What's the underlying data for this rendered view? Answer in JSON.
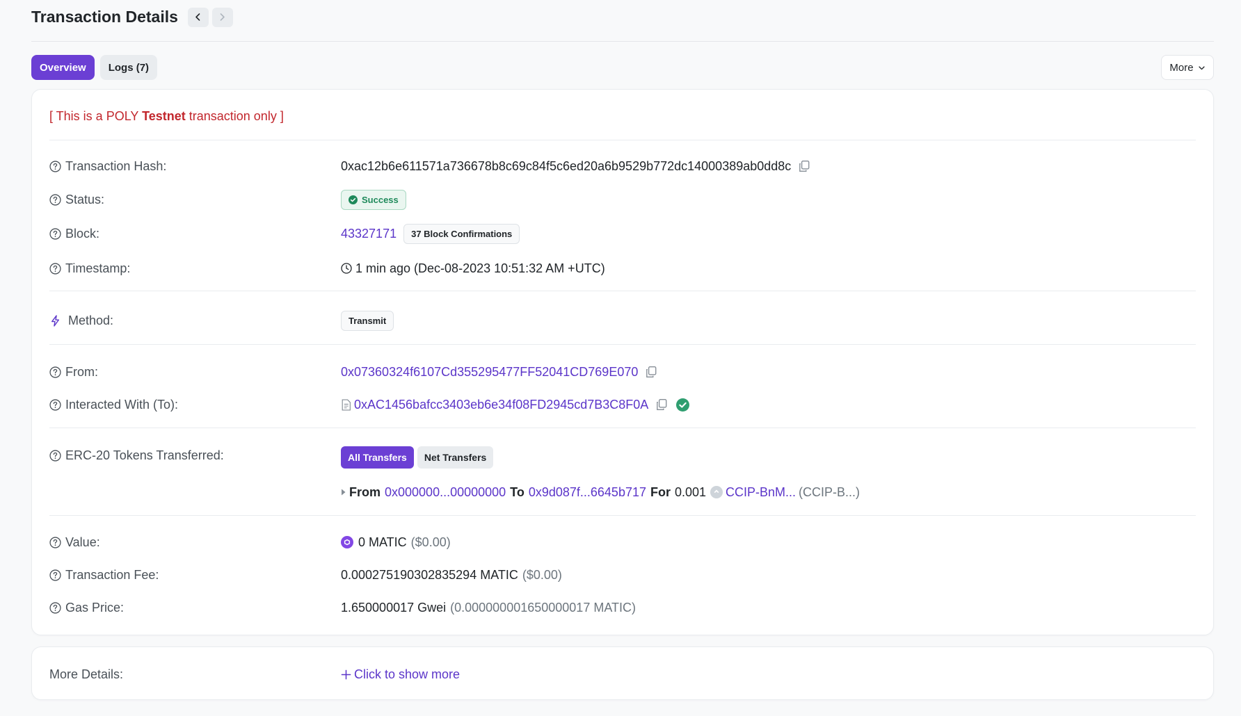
{
  "header": {
    "title": "Transaction Details"
  },
  "tabs": [
    {
      "label": "Overview",
      "active": true
    },
    {
      "label": "Logs (7)",
      "active": false
    }
  ],
  "more_label": "More",
  "notice": {
    "prefix": "[ This is a POLY ",
    "bold": "Testnet",
    "suffix": " transaction only ]"
  },
  "fields": {
    "tx_hash": {
      "label": "Transaction Hash:",
      "value": "0xac12b6e611571a736678b8c69c84f5c6ed20a6b9529b772dc14000389ab0dd8c"
    },
    "status": {
      "label": "Status:",
      "value": "Success"
    },
    "block": {
      "label": "Block:",
      "value": "43327171",
      "confirmations": "37 Block Confirmations"
    },
    "timestamp": {
      "label": "Timestamp:",
      "value": "1 min ago (Dec-08-2023 10:51:32 AM +UTC)"
    },
    "method": {
      "label": "Method:",
      "value": "Transmit"
    },
    "from": {
      "label": "From:",
      "value": "0x07360324f6107Cd355295477FF52041CD769E070"
    },
    "to": {
      "label": "Interacted With (To):",
      "value": "0xAC1456bafcc3403eb6e34f08FD2945cd7B3C8F0A"
    },
    "erc20": {
      "label": "ERC-20 Tokens Transferred:",
      "buttons": [
        "All Transfers",
        "Net Transfers"
      ],
      "transfer": {
        "from_kw": "From",
        "from_addr": "0x000000...00000000",
        "to_kw": "To",
        "to_addr": "0x9d087f...6645b717",
        "for_kw": "For",
        "amount": "0.001",
        "token": "CCIP-BnM...",
        "token_symbol": "(CCIP-B...)"
      }
    },
    "value": {
      "label": "Value:",
      "amount": "0 MATIC",
      "usd": "($0.00)"
    },
    "fee": {
      "label": "Transaction Fee:",
      "amount": "0.000275190302835294 MATIC",
      "usd": "($0.00)"
    },
    "gas": {
      "label": "Gas Price:",
      "amount": "1.650000017 Gwei",
      "detail": "(0.000000001650000017 MATIC)"
    }
  },
  "more_details": {
    "label": "More Details:",
    "action": "Click to show more"
  },
  "colors": {
    "accent": "#6b3fd4",
    "link": "#5b35c9",
    "success": "#1f8a5b",
    "warning_text": "#c2272d"
  }
}
